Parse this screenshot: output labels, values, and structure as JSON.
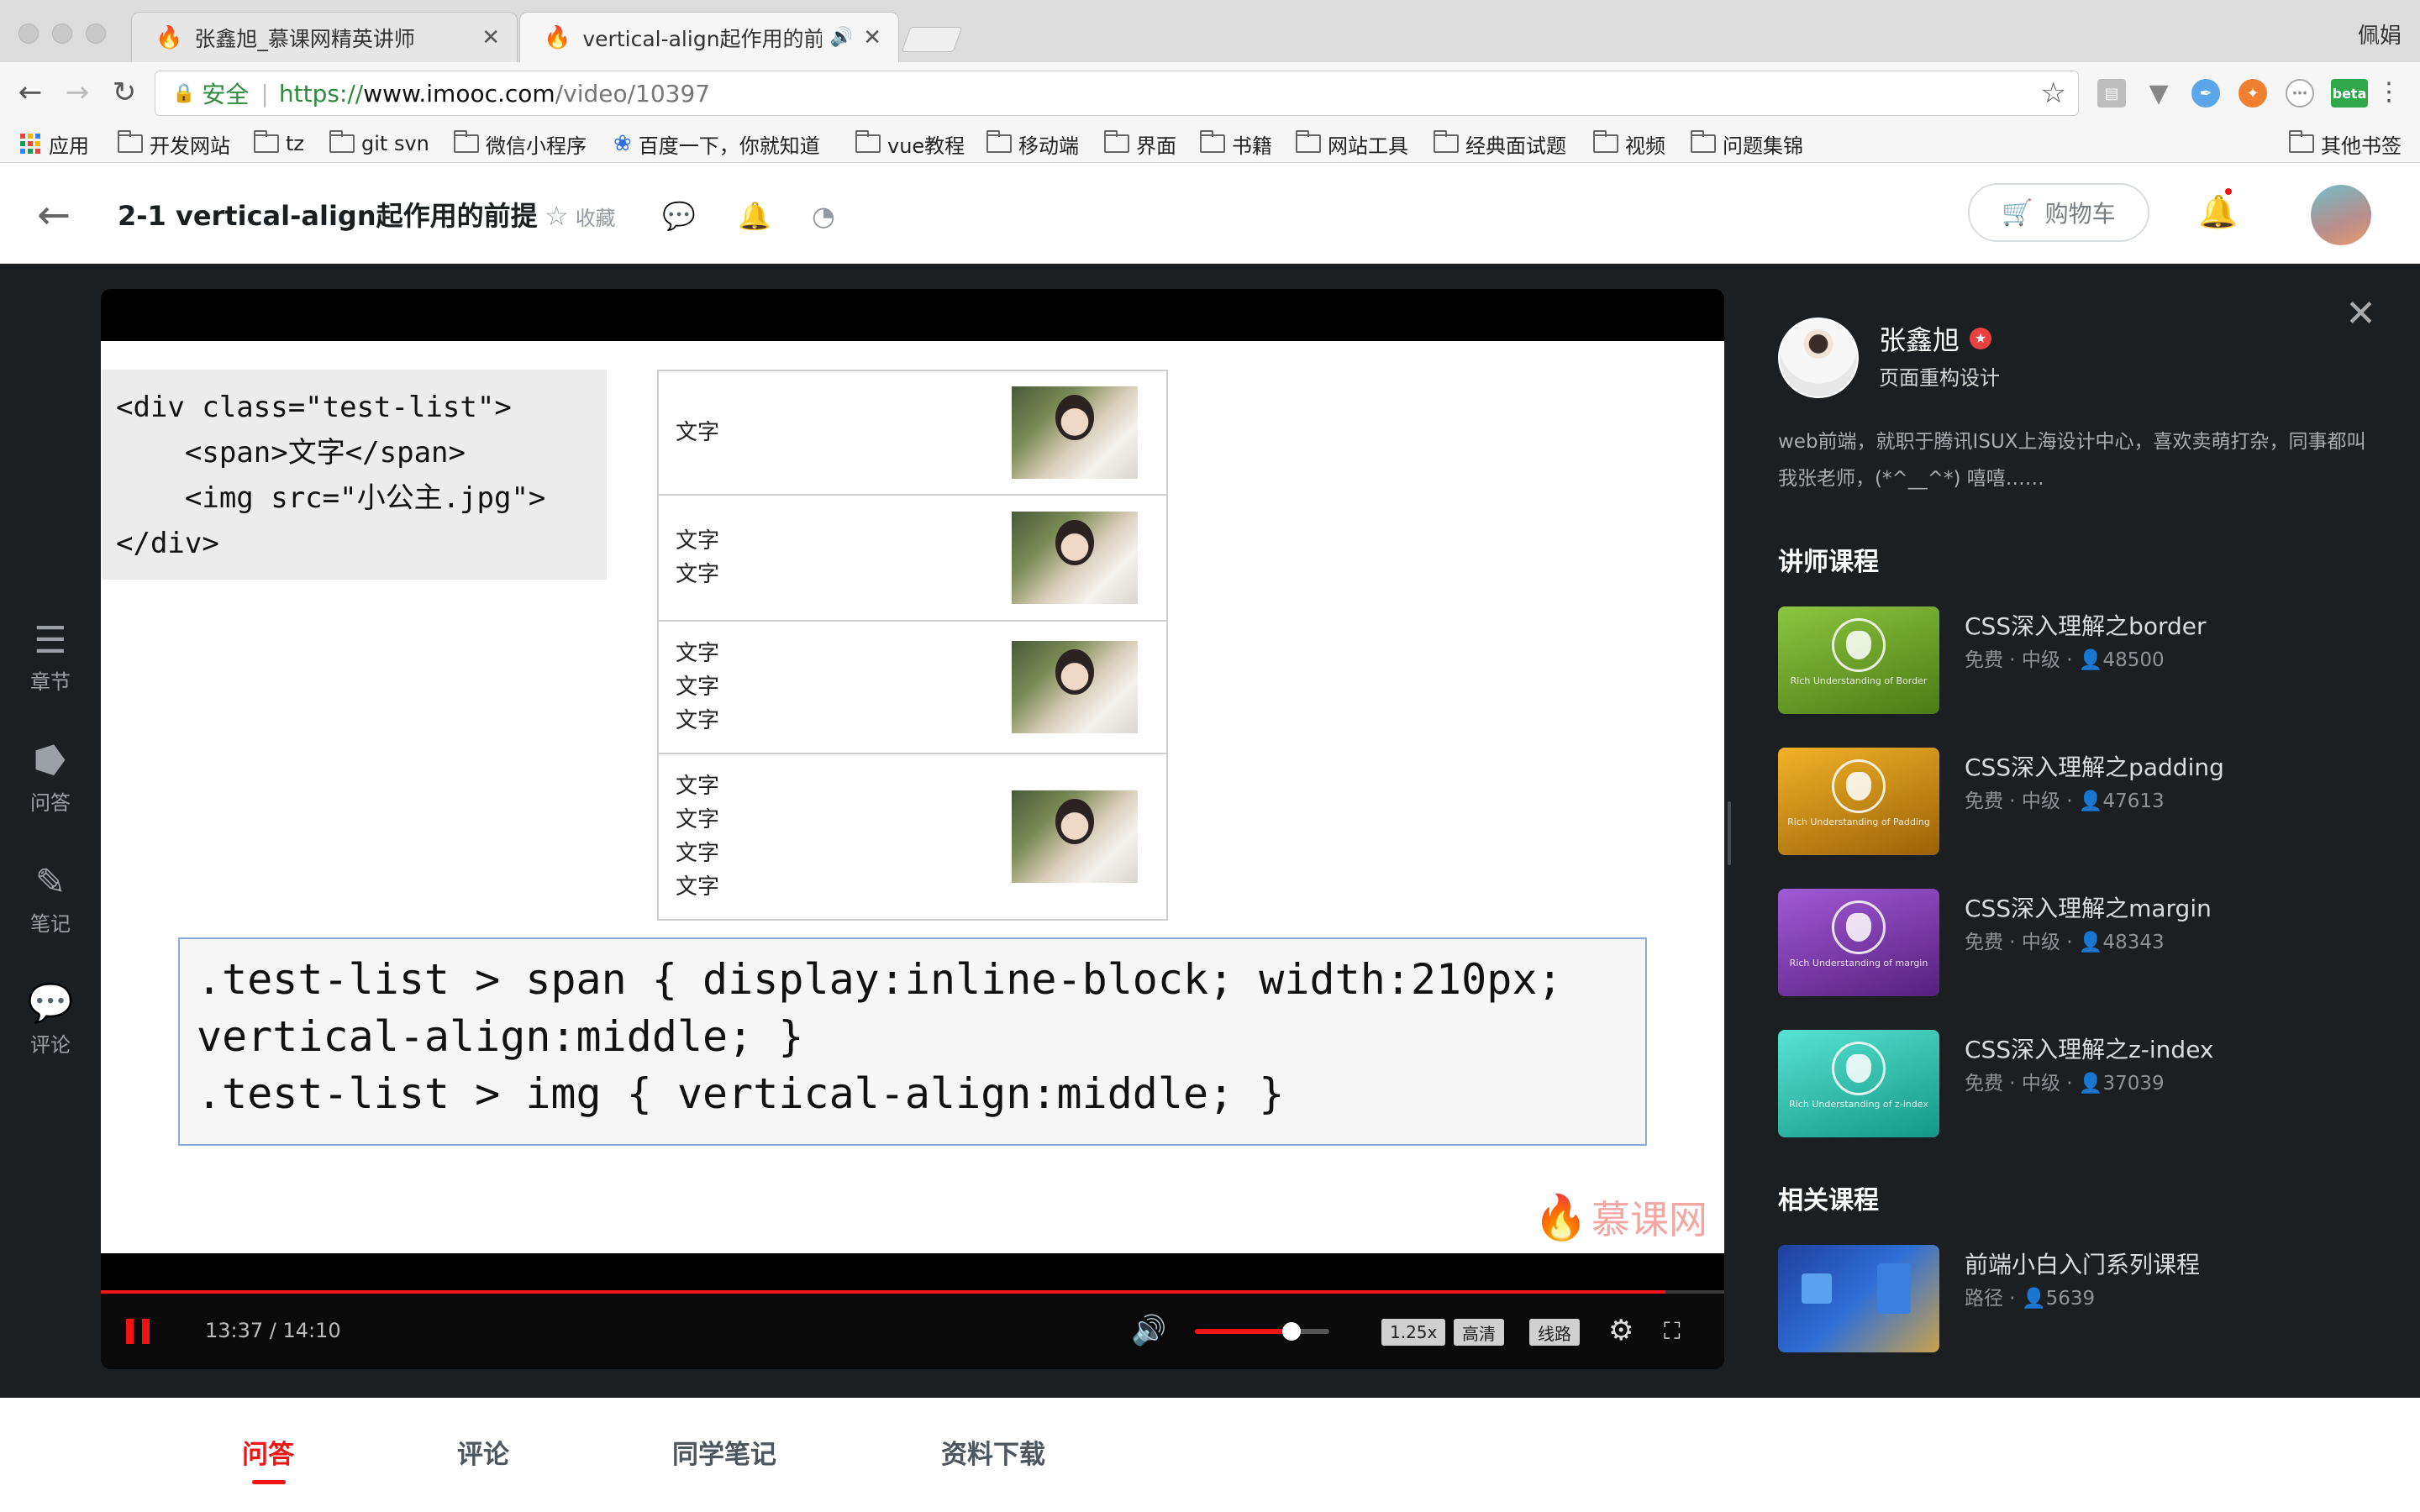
{
  "browser": {
    "tabs": [
      {
        "title": "张鑫旭_慕课网精英讲师"
      },
      {
        "title": "vertical-align起作用的前提，"
      }
    ],
    "profile_name": "佩娟",
    "address": {
      "secure_label": "安全",
      "scheme": "https://",
      "host": "www.imooc.com",
      "path": "/video/10397"
    },
    "extension_badge": "beta",
    "bookmarks": [
      {
        "label": "应用",
        "icon": "apps-grid-icon"
      },
      {
        "label": "开发网站",
        "icon": "folder-icon"
      },
      {
        "label": "tz",
        "icon": "folder-icon"
      },
      {
        "label": "git svn",
        "icon": "folder-icon"
      },
      {
        "label": "微信小程序",
        "icon": "folder-icon"
      },
      {
        "label": "百度一下，你就知道",
        "icon": "baidu-paw-icon"
      },
      {
        "label": "vue教程",
        "icon": "folder-icon"
      },
      {
        "label": "移动端",
        "icon": "folder-icon"
      },
      {
        "label": "界面",
        "icon": "folder-icon"
      },
      {
        "label": "书籍",
        "icon": "folder-icon"
      },
      {
        "label": "网站工具",
        "icon": "folder-icon"
      },
      {
        "label": "经典面试题",
        "icon": "folder-icon"
      },
      {
        "label": "视频",
        "icon": "folder-icon"
      },
      {
        "label": "问题集锦",
        "icon": "folder-icon"
      }
    ],
    "other_bookmarks": "其他书签"
  },
  "header": {
    "title": "2-1 vertical-align起作用的前提",
    "collect_label": "收藏",
    "cart_label": "购物车"
  },
  "sidebar": {
    "items": [
      {
        "label": "章节",
        "icon": "chapters-icon"
      },
      {
        "label": "问答",
        "icon": "qa-icon"
      },
      {
        "label": "笔记",
        "icon": "note-icon"
      },
      {
        "label": "评论",
        "icon": "comment-icon"
      }
    ]
  },
  "slide": {
    "html_code": "<div class=\"test-list\">\n    <span>文字</span>\n    <img src=\"小公主.jpg\">\n</div>",
    "demo_rows": [
      "文字",
      "文字\n文字",
      "文字\n文字\n文字",
      "文字\n文字\n文字\n文字"
    ],
    "css_code": ".test-list > span { display:inline-block; width:210px;\nvertical-align:middle; }\n.test-list > img { vertical-align:middle; }",
    "watermark": "慕课网"
  },
  "player": {
    "current_time": "13:37",
    "duration": "14:10",
    "time_display": "13:37 / 14:10",
    "progress": 0.964,
    "volume": 0.72,
    "speed_label": "1.25x",
    "quality_label": "高清",
    "line_label": "线路"
  },
  "teacher": {
    "name": "张鑫旭",
    "title": "页面重构设计",
    "bio": "web前端，就职于腾讯ISUX上海设计中心，喜欢卖萌打杂，同事都叫我张老师，(*^__^*) 嘻嘻……"
  },
  "teacher_courses": {
    "heading": "讲师课程",
    "items": [
      {
        "name": "CSS深入理解之border",
        "meta": "免费 · 中级 · ",
        "students": "48500",
        "caption": "Rich Understanding of Border",
        "color_from": "#8cc63f",
        "color_to": "#4c7a16"
      },
      {
        "name": "CSS深入理解之padding",
        "meta": "免费 · 中级 · ",
        "students": "47613",
        "caption": "Rich Understanding of Padding",
        "color_from": "#f2b227",
        "color_to": "#9a6208"
      },
      {
        "name": "CSS深入理解之margin",
        "meta": "免费 · 中级 · ",
        "students": "48343",
        "caption": "Rich Understanding of margin",
        "color_from": "#a15ad6",
        "color_to": "#56207e"
      },
      {
        "name": "CSS深入理解之z-index",
        "meta": "免费 · 中级 · ",
        "students": "37039",
        "caption": "Rich Understanding of z-index",
        "color_from": "#57e3d2",
        "color_to": "#159786"
      }
    ]
  },
  "related_courses": {
    "heading": "相关课程",
    "items": [
      {
        "name": "前端小白入门系列课程",
        "meta": "路径 · ",
        "students": "5639"
      }
    ]
  },
  "bottom_tabs": [
    "问答",
    "评论",
    "同学笔记",
    "资料下载"
  ],
  "colors": {
    "accent": "#f01414",
    "dark_bg": "#1c1f21",
    "secure_green": "#2e8b3d"
  }
}
